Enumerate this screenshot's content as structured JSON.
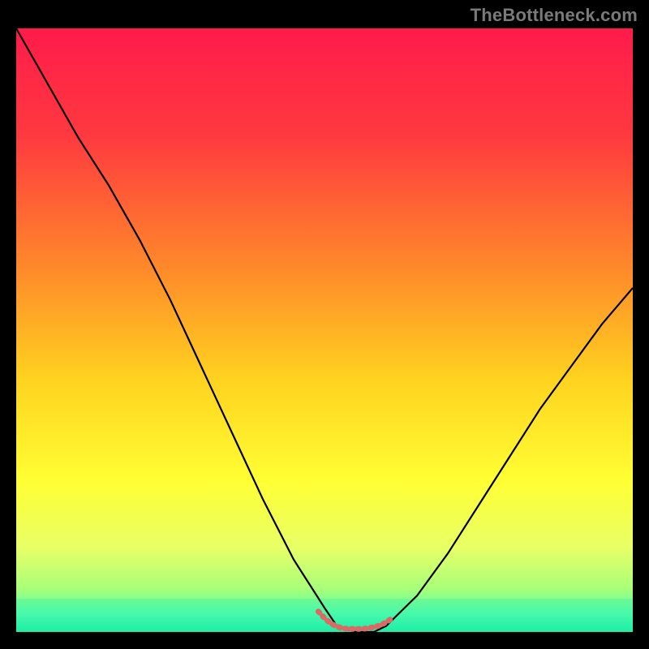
{
  "watermark": "TheBottleneck.com",
  "chart_data": {
    "type": "line",
    "title": "",
    "xlabel": "",
    "ylabel": "",
    "xlim": [
      0,
      100
    ],
    "ylim": [
      0,
      100
    ],
    "gradient_stops": [
      {
        "offset": 0.0,
        "color": "#ff1b4b"
      },
      {
        "offset": 0.18,
        "color": "#ff3a3f"
      },
      {
        "offset": 0.4,
        "color": "#ff8a2a"
      },
      {
        "offset": 0.58,
        "color": "#ffd21f"
      },
      {
        "offset": 0.75,
        "color": "#ffff33"
      },
      {
        "offset": 0.86,
        "color": "#e8ff66"
      },
      {
        "offset": 0.93,
        "color": "#a7ff7a"
      },
      {
        "offset": 0.97,
        "color": "#4dffb0"
      },
      {
        "offset": 1.0,
        "color": "#18f0a8"
      }
    ],
    "series": [
      {
        "name": "bottleneck-curve",
        "stroke": "#000000",
        "x": [
          0,
          5,
          10,
          15,
          20,
          25,
          30,
          35,
          40,
          45,
          50,
          52,
          55,
          58,
          60,
          65,
          70,
          75,
          80,
          85,
          90,
          95,
          100
        ],
        "values": [
          100,
          91,
          82,
          74,
          65,
          55,
          44,
          33,
          22,
          12,
          4,
          1,
          0,
          0,
          1,
          6,
          13,
          21,
          29,
          37,
          44,
          51,
          57
        ]
      },
      {
        "name": "valley-highlight",
        "stroke": "#d96a66",
        "style": "thick-dashed",
        "x": [
          49,
          50,
          51,
          52,
          53,
          54,
          55,
          56,
          57,
          58,
          59,
          60,
          61
        ],
        "values": [
          3.4,
          2.3,
          1.4,
          0.9,
          0.6,
          0.5,
          0.5,
          0.5,
          0.6,
          0.8,
          1.1,
          1.6,
          2.3
        ]
      }
    ],
    "green_band": {
      "top_pct": 94.5,
      "bottom_pct": 100
    }
  }
}
